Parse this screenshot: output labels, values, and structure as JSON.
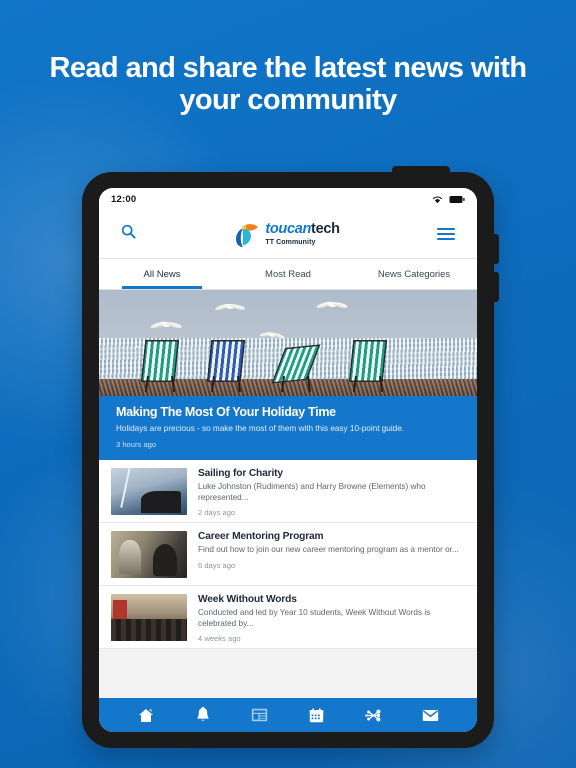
{
  "promo": {
    "headline": "Read and share the latest news with your community",
    "background_color": "#0d6cbd"
  },
  "device": {
    "status_bar": {
      "time": "12:00",
      "wifi_icon": "wifi-icon",
      "battery_icon": "battery-icon"
    }
  },
  "app": {
    "header": {
      "search_icon": "search-icon",
      "menu_icon": "hamburger-menu-icon",
      "logo": {
        "name_italic": "toucan",
        "name_bold": "tech",
        "subtitle": "TT Community",
        "colors": {
          "yellow": "#f5c518",
          "orange": "#f07d1e",
          "cyan": "#29b6d8",
          "blue": "#1463b0",
          "text": "#1a2a3a",
          "accent": "#1477cc"
        }
      }
    },
    "tabs": [
      {
        "label": "All News",
        "active": true
      },
      {
        "label": "Most Read",
        "active": false
      },
      {
        "label": "News Categories",
        "active": false
      }
    ],
    "hero": {
      "image_alt": "beach-deck-chairs-and-seagulls-photo",
      "title": "Making The Most Of Your Holiday Time",
      "description": "Holidays are precious - so make the most of them with this easy 10-point guide.",
      "time": "3 hours ago"
    },
    "news_items": [
      {
        "thumb": "sailing-boat-thumbnail",
        "title": "Sailing for Charity",
        "description": "Luke Johnston (Rudiments) and Harry Browne (Elements) who represented...",
        "time": "2 days ago"
      },
      {
        "thumb": "career-mentoring-conversation-thumbnail",
        "title": "Career Mentoring Program",
        "description": "Find out how to join our new career mentoring program as a mentor or...",
        "time": "6 days ago"
      },
      {
        "thumb": "crowded-street-thumbnail",
        "title": "Week Without Words",
        "description": "Conducted and led by Year 10 students, Week Without Words is celebrated by...",
        "time": "4 weeks ago"
      }
    ],
    "bottom_nav": [
      {
        "icon": "home-icon",
        "active": false
      },
      {
        "icon": "bell-notifications-icon",
        "active": false
      },
      {
        "icon": "news-feed-icon",
        "active": true
      },
      {
        "icon": "calendar-events-icon",
        "active": false
      },
      {
        "icon": "network-connections-icon",
        "active": false
      },
      {
        "icon": "envelope-mail-icon",
        "active": false
      }
    ]
  }
}
